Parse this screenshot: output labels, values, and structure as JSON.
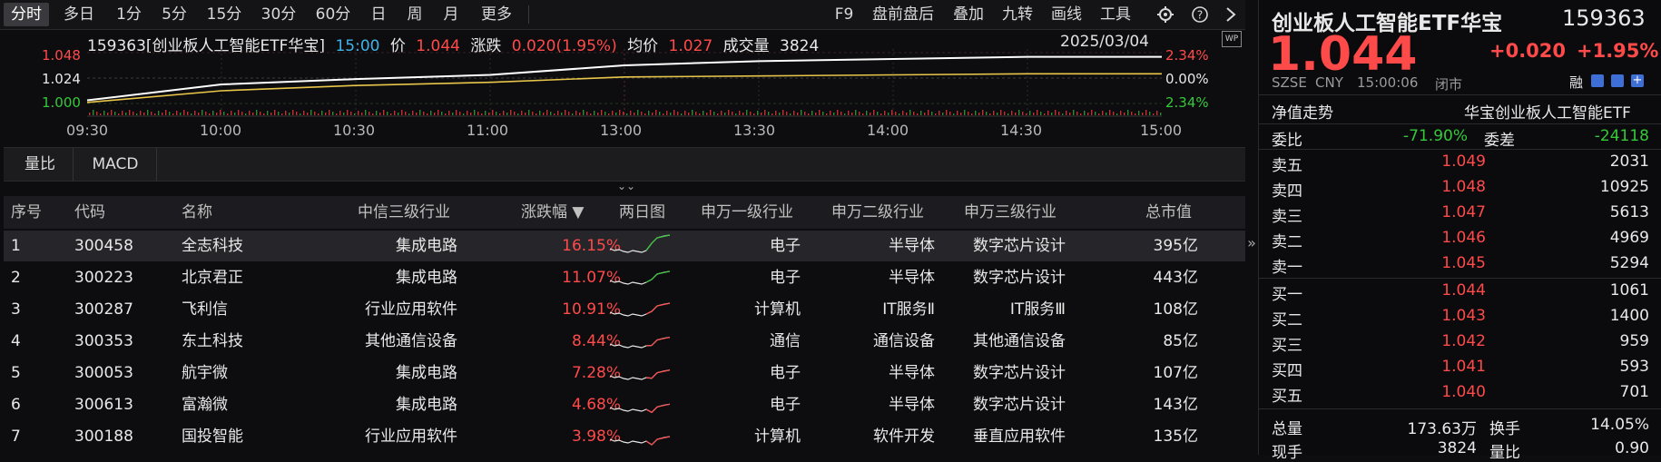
{
  "tabs": [
    "分时",
    "多日",
    "1分",
    "5分",
    "15分",
    "30分",
    "60分",
    "日",
    "周",
    "月",
    "更多"
  ],
  "toolbar_right": [
    "F9",
    "盘前盘后",
    "叠加",
    "九转",
    "画线",
    "工具"
  ],
  "chart": {
    "info": {
      "code_name": "159363[创业板人工智能ETF华宝]",
      "time": "15:00",
      "price_label": "价",
      "price": "1.044",
      "chg_label": "涨跌",
      "chg": "0.020(1.95%)",
      "avg_label": "均价",
      "avg": "1.027",
      "vol_label": "成交量",
      "vol": "3824"
    },
    "date": "2025/03/04",
    "y_left": [
      "1.048",
      "1.024",
      "1.000"
    ],
    "y_right": [
      "2.34%",
      "0.00%",
      "2.34%"
    ],
    "x_labels": [
      "09:30",
      "10:00",
      "10:30",
      "11:00",
      "13:00",
      "13:30",
      "14:00",
      "14:30",
      "15:00"
    ]
  },
  "chart_data": {
    "type": "line",
    "x": [
      "09:30",
      "10:00",
      "10:30",
      "11:00",
      "13:00",
      "13:30",
      "14:00",
      "14:30",
      "15:00"
    ],
    "series": [
      {
        "name": "价",
        "values": [
          1.003,
          1.018,
          1.023,
          1.027,
          1.036,
          1.04,
          1.042,
          1.044,
          1.044
        ]
      },
      {
        "name": "均价",
        "values": [
          1.001,
          1.012,
          1.017,
          1.02,
          1.025,
          1.026,
          1.027,
          1.028,
          1.028
        ]
      }
    ],
    "ylim": [
      1.0,
      1.048
    ]
  },
  "mid_tabs": [
    "量比",
    "MACD"
  ],
  "table": {
    "headers": [
      "序号",
      "代码",
      "名称",
      "中信三级行业",
      "涨跌幅 ▼",
      "两日图",
      "申万一级行业",
      "申万二级行业",
      "申万三级行业",
      "总市值"
    ],
    "rows": [
      [
        "1",
        "300458",
        "全志科技",
        "集成电路",
        "16.15%",
        "",
        "电子",
        "半导体",
        "数字芯片设计",
        "395亿"
      ],
      [
        "2",
        "300223",
        "北京君正",
        "集成电路",
        "11.07%",
        "",
        "电子",
        "半导体",
        "数字芯片设计",
        "443亿"
      ],
      [
        "3",
        "300287",
        "飞利信",
        "行业应用软件",
        "10.91%",
        "",
        "计算机",
        "IT服务Ⅱ",
        "IT服务Ⅲ",
        "108亿"
      ],
      [
        "4",
        "300353",
        "东土科技",
        "其他通信设备",
        "8.44%",
        "",
        "通信",
        "通信设备",
        "其他通信设备",
        "85亿"
      ],
      [
        "5",
        "300053",
        "航宇微",
        "集成电路",
        "7.28%",
        "",
        "电子",
        "半导体",
        "数字芯片设计",
        "107亿"
      ],
      [
        "6",
        "300613",
        "富瀚微",
        "集成电路",
        "4.68%",
        "",
        "电子",
        "半导体",
        "数字芯片设计",
        "143亿"
      ],
      [
        "7",
        "300188",
        "国投智能",
        "行业应用软件",
        "3.98%",
        "",
        "计算机",
        "软件开发",
        "垂直应用软件",
        "135亿"
      ]
    ]
  },
  "quote": {
    "name": "创业板人工智能ETF华宝",
    "code": "159363",
    "price": "1.044",
    "chg": "+0.020",
    "pct": "+1.95%",
    "exchange": "SZSE",
    "currency": "CNY",
    "time": "15:00:06",
    "status": "闭市",
    "rong": "融",
    "nav_label": "净值走势",
    "nav_name": "华宝创业板人工智能ETF",
    "weibi_label": "委比",
    "weibi": "-71.90%",
    "weicha_label": "委差",
    "weicha": "-24118",
    "asks": [
      [
        "卖五",
        "1.049",
        "2031"
      ],
      [
        "卖四",
        "1.048",
        "10925"
      ],
      [
        "卖三",
        "1.047",
        "5613"
      ],
      [
        "卖二",
        "1.046",
        "4969"
      ],
      [
        "卖一",
        "1.045",
        "5294"
      ]
    ],
    "bids": [
      [
        "买一",
        "1.044",
        "1061"
      ],
      [
        "买二",
        "1.043",
        "1400"
      ],
      [
        "买三",
        "1.042",
        "959"
      ],
      [
        "买四",
        "1.041",
        "593"
      ],
      [
        "买五",
        "1.040",
        "701"
      ]
    ],
    "total_label": "总量",
    "total": "173.63万",
    "turnover_label": "换手",
    "turnover": "14.05%",
    "cur_label": "现手",
    "cur": "3824",
    "lb_label": "量比",
    "lb": "0.90"
  },
  "colors": {
    "up": "#ff4a4a",
    "down": "#35c93a",
    "price_line": "#ffffff",
    "avg_line": "#e8c64a"
  }
}
